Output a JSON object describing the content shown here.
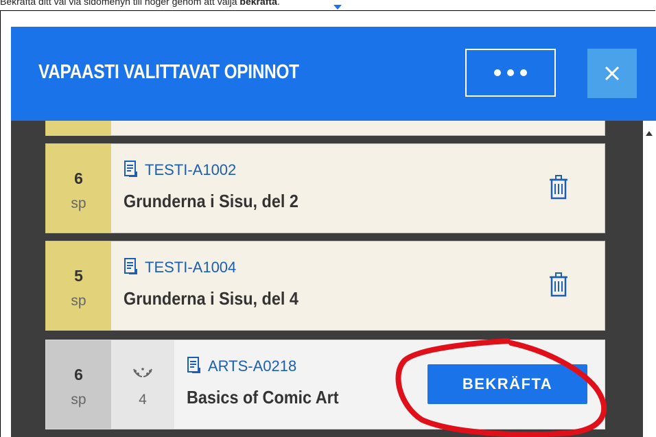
{
  "caption": {
    "text_before": "Bekräfta ditt val via sidomenyn till höger genom att välja ",
    "bold": "bekräfta",
    "text_after": "."
  },
  "panel": {
    "title": "VAPAASTI VALITTAVAT OPINNOT",
    "more_icon": "more-horizontal-icon",
    "close_icon": "close-icon",
    "header_color": "#1a73e8"
  },
  "courses": [
    {
      "credits": "6",
      "unit": "sp",
      "code": "TESTI-A1002",
      "name": "Grunderna i Sisu, del 2",
      "action_icon": "trash-icon"
    },
    {
      "credits": "5",
      "unit": "sp",
      "code": "TESTI-A1004",
      "name": "Grunderna i Sisu, del 4",
      "action_icon": "trash-icon"
    }
  ],
  "pending_course": {
    "credits": "6",
    "unit": "sp",
    "grade": "4",
    "grade_icon": "laurel-icon",
    "code": "ARTS-A0218",
    "name": "Basics of Comic Art",
    "confirm_label": "BEKRÄFTA"
  },
  "annotation": {
    "color": "#e0101a"
  }
}
